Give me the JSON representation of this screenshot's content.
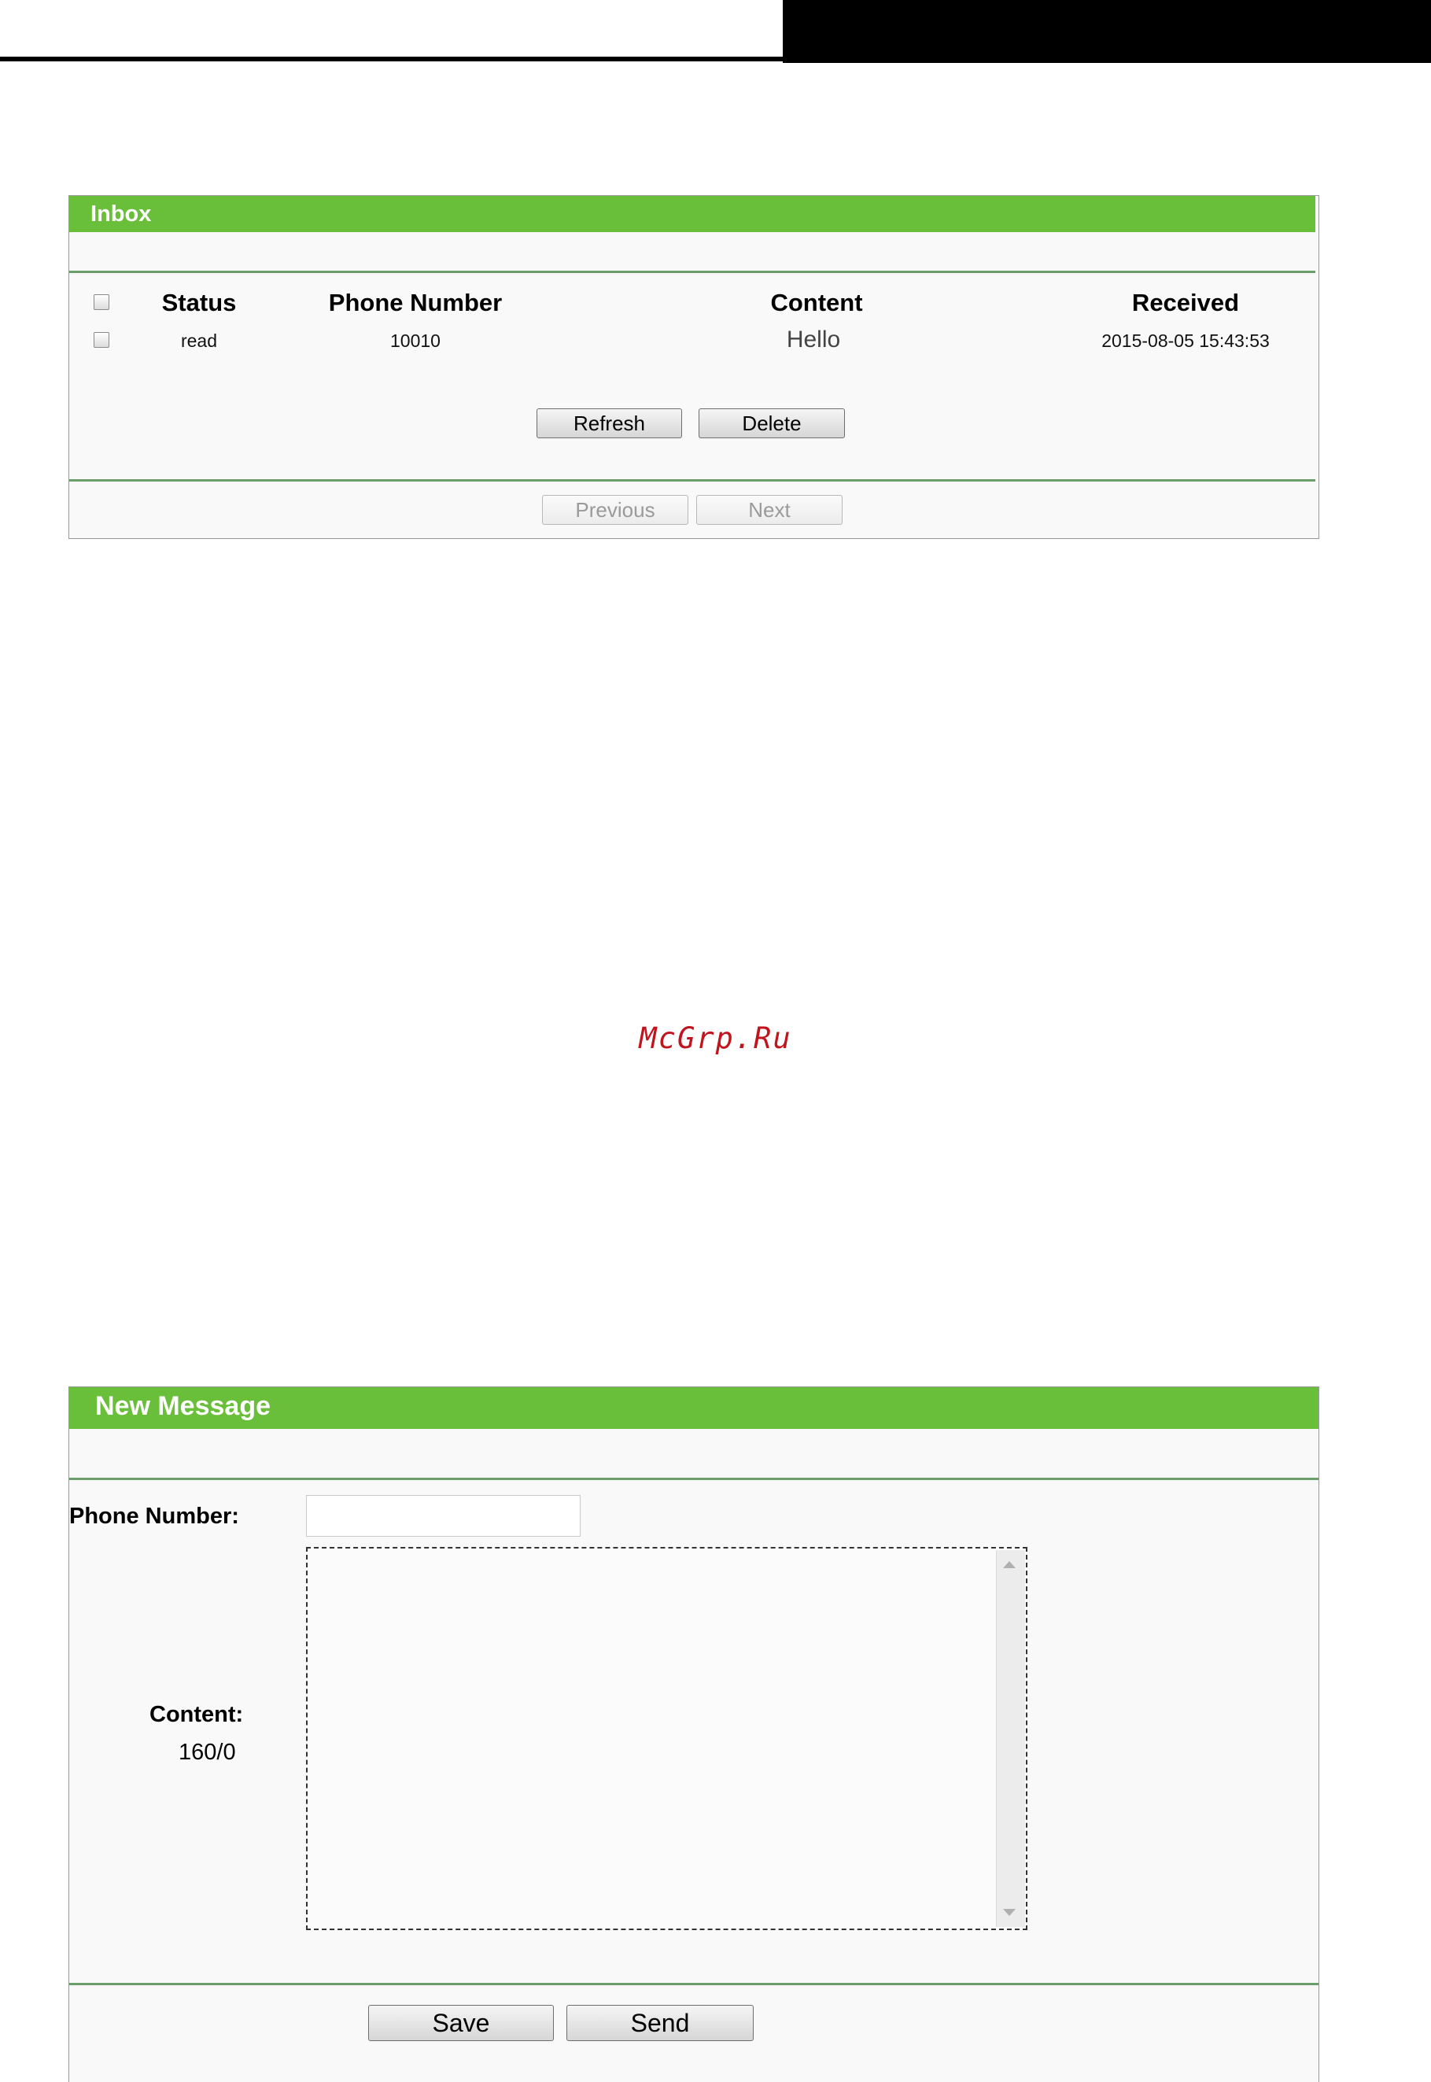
{
  "inbox": {
    "title": "Inbox",
    "columns": {
      "status": "Status",
      "phone_number": "Phone Number",
      "content": "Content",
      "received": "Received"
    },
    "rows": [
      {
        "status": "read",
        "phone_number": "10010",
        "content": "Hello",
        "received": "2015-08-05 15:43:53"
      }
    ],
    "buttons": {
      "refresh": "Refresh",
      "delete": "Delete"
    },
    "pager": {
      "previous": "Previous",
      "next": "Next"
    }
  },
  "watermark": "McGrp.Ru",
  "new_message": {
    "title": "New Message",
    "phone_label": "Phone Number:",
    "phone_value": "",
    "content_label": "Content:",
    "content_value": "",
    "counter": "160/0",
    "buttons": {
      "save": "Save",
      "send": "Send"
    }
  }
}
